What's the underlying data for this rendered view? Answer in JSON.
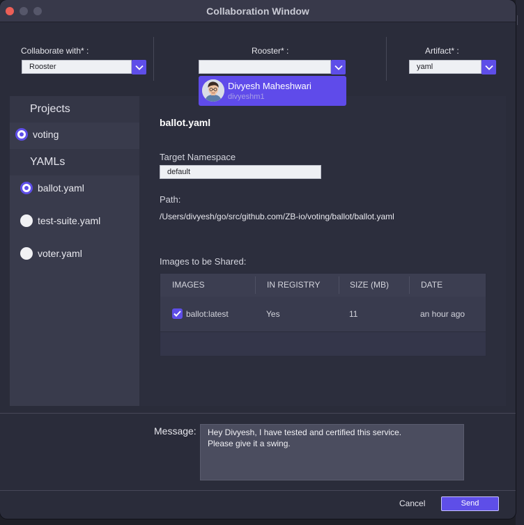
{
  "window": {
    "title": "Collaboration Window"
  },
  "colors": {
    "accent": "#5e4ee8",
    "window_bg": "#2a2c3a",
    "sidebar_bg": "#393b4c",
    "close": "#ec5f57"
  },
  "header": {
    "collaborate": {
      "label": "Collaborate with* :",
      "value": "Rooster"
    },
    "rooster": {
      "label": "Rooster* :",
      "value": ""
    },
    "artifact": {
      "label": "Artifact* :",
      "value": "yaml"
    }
  },
  "dropdown": {
    "name": "Divyesh Maheshwari",
    "username": "divyeshm1"
  },
  "sidebar": {
    "projects_header": "Projects",
    "projects": [
      {
        "label": "voting",
        "selected": true
      }
    ],
    "yamls_header": "YAMLs",
    "yamls": [
      {
        "label": "ballot.yaml",
        "selected": true
      },
      {
        "label": "test-suite.yaml",
        "selected": false
      },
      {
        "label": "voter.yaml",
        "selected": false
      }
    ]
  },
  "main": {
    "title": "ballot.yaml",
    "namespace_label": "Target Namespace",
    "namespace_value": "default",
    "path_label": "Path:",
    "path_value": "/Users/divyesh/go/src/github.com/ZB-io/voting/ballot/ballot.yaml",
    "images_label": "Images to be Shared:",
    "table": {
      "headers": [
        "IMAGES",
        "IN REGISTRY",
        "SIZE (MB)",
        "DATE"
      ],
      "rows": [
        {
          "checked": true,
          "image": "ballot:latest",
          "in_registry": "Yes",
          "size": "11",
          "date": "an hour ago"
        }
      ]
    }
  },
  "footer": {
    "message_label": "Message:",
    "message_line1": "Hey Divyesh, I have tested and certified this service.",
    "message_line2": "Please give it a swing.",
    "cancel_label": "Cancel",
    "send_label": "Send"
  }
}
